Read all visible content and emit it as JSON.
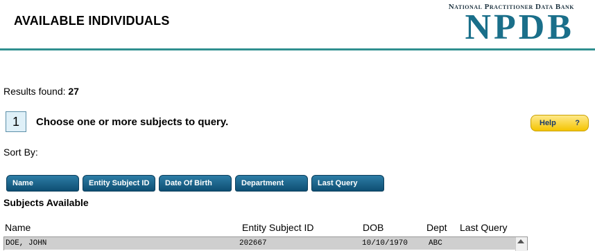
{
  "header": {
    "title": "AVAILABLE INDIVIDUALS",
    "logo_small": "National Practitioner Data Bank",
    "logo_big": "NPDB"
  },
  "results": {
    "label": "Results found:",
    "count": "27"
  },
  "step": {
    "number": "1",
    "text": "Choose one or more subjects to query."
  },
  "help": {
    "label": "Help",
    "icon": "?"
  },
  "sort": {
    "label": "Sort By:",
    "buttons": [
      "Name",
      "Entity Subject ID",
      "Date Of Birth",
      "Department",
      "Last Query"
    ]
  },
  "subjects": {
    "title": "Subjects Available",
    "columns": [
      "Name",
      "Entity Subject ID",
      "DOB",
      "Dept",
      "Last Query"
    ],
    "rows": [
      {
        "name": "DOE, JOHN",
        "id": "202667",
        "dob": "10/10/1970",
        "dept": "ABC",
        "last_query": ""
      }
    ]
  }
}
